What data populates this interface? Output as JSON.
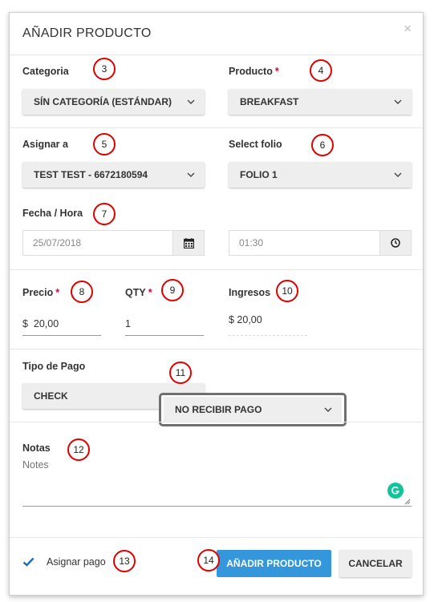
{
  "modal": {
    "title": "AÑADIR PRODUCTO",
    "close_glyph": "×"
  },
  "categoria": {
    "label": "Categoria",
    "value": "SÍN CATEGORÍA (ESTÁNDAR)"
  },
  "producto": {
    "label": "Producto",
    "required_mark": "*",
    "value": "BREAKFAST"
  },
  "asignar": {
    "label": "Asignar a",
    "value": "TEST TEST - 6672180594"
  },
  "folio": {
    "label": "Select folio",
    "value": "FOLIO 1"
  },
  "fecha": {
    "label": "Fecha / Hora",
    "date_value": "25/07/2018",
    "time_value": "01:30"
  },
  "precio": {
    "label": "Precio",
    "required_mark": "*",
    "currency": "$",
    "value": "20,00"
  },
  "qty": {
    "label": "QTY",
    "required_mark": "*",
    "value": "1"
  },
  "ingresos": {
    "label": "Ingresos",
    "value": "$ 20,00"
  },
  "tipo_pago": {
    "label": "Tipo de Pago",
    "value": "CHECK",
    "dropdown_option": "NO RECIBIR PAGO"
  },
  "notas": {
    "label": "Notas",
    "placeholder": "Notes"
  },
  "footer": {
    "checkbox_label": "Asignar pago",
    "checked": true,
    "primary_button": "AÑADIR PRODUCTO",
    "cancel_button": "CANCELAR"
  },
  "annotations": [
    "3",
    "4",
    "5",
    "6",
    "7",
    "8",
    "9",
    "10",
    "11",
    "12",
    "13",
    "14"
  ],
  "colors": {
    "primary": "#3497db",
    "required": "#e0003c",
    "badge_border": "#e00000",
    "check": "#1b6bb5"
  }
}
